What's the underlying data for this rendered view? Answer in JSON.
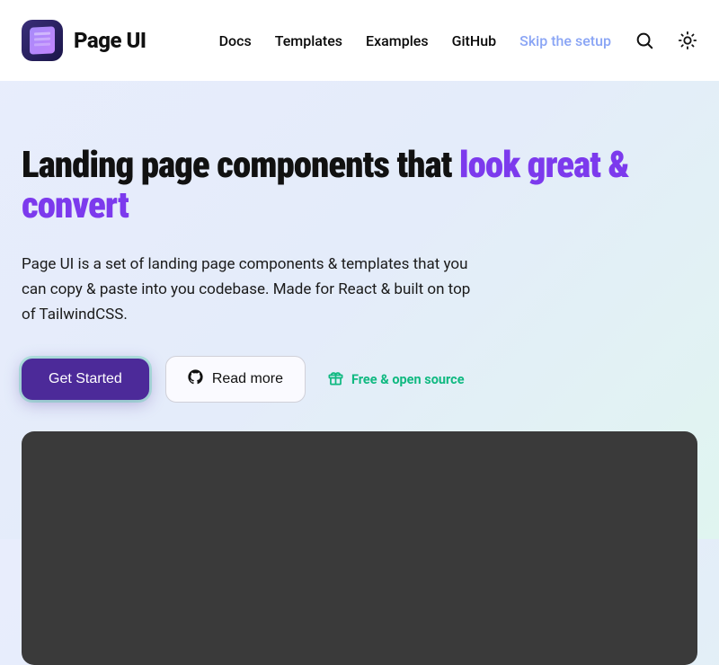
{
  "header": {
    "brand": "Page UI",
    "nav": {
      "docs": "Docs",
      "templates": "Templates",
      "examples": "Examples",
      "github": "GitHub",
      "skip": "Skip the setup"
    }
  },
  "hero": {
    "title_plain": "Landing page components that ",
    "title_accent": "look great & convert",
    "description": "Page UI is a set of landing page components & templates that you can copy & paste into you codebase. Made for React & built on top of TailwindCSS.",
    "cta_primary": "Get Started",
    "cta_secondary": "Read more",
    "badge": "Free & open source"
  }
}
